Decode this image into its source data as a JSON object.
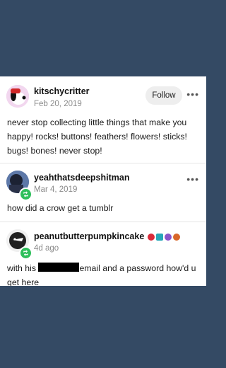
{
  "posts": [
    {
      "username": "kitschycritter",
      "date": "Feb 20, 2019",
      "follow_label": "Follow",
      "text": "never stop collecting little things that make you happy! rocks! buttons! feathers! flowers! sticks! bugs! bones! never stop!"
    },
    {
      "username": "yeahthatsdeepshitman",
      "date": "Mar 4, 2019",
      "text": "how did a crow get a tumblr"
    },
    {
      "username": "peanutbutterpumpkincake",
      "date": "4d ago",
      "text_before": "with his",
      "text_after": "email and a password how'd u get here"
    }
  ],
  "more_label": "•••",
  "colors": {
    "background": "#344a64",
    "reblog": "#2fbf5b"
  }
}
